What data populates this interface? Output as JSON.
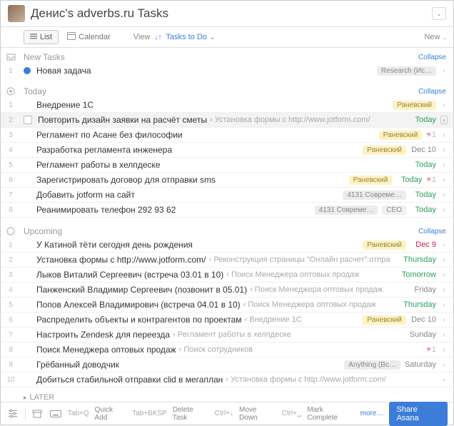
{
  "header": {
    "title": "Денис's adverbs.ru Tasks"
  },
  "toolbar": {
    "list_label": "List",
    "calendar_label": "Calendar",
    "view_label": "View",
    "filter_label": "Tasks to Do",
    "new_label": "New"
  },
  "sections": {
    "new": {
      "title": "New Tasks",
      "collapse": "Collapse"
    },
    "today": {
      "title": "Today",
      "collapse": "Collapse"
    },
    "upcoming": {
      "title": "Upcoming",
      "collapse": "Collapse"
    }
  },
  "tasks": {
    "new": [
      {
        "n": "1",
        "name": "Новая задача",
        "tag": "Research (Ис…",
        "tag_style": "gray"
      }
    ],
    "today": [
      {
        "n": "1",
        "name": "Внедрение 1С",
        "tag": "Раневский",
        "tag_style": "yellow"
      },
      {
        "n": "2",
        "name": "Повторить дизайн заявки на расчёт сметы",
        "sub": "‹ Установка формы с http://www.jotform.com/",
        "due": "Today",
        "due_style": "green",
        "selected": true
      },
      {
        "n": "3",
        "name": "Регламент по Асане без философии",
        "tag": "Раневский",
        "tag_style": "yellow",
        "heart": "1"
      },
      {
        "n": "4",
        "name": "Разработка регламента инженера",
        "tag": "Раневский",
        "tag_style": "yellow",
        "due": "Dec 10"
      },
      {
        "n": "5",
        "name": "Регламент работы в хелпдеске",
        "due": "Today",
        "due_style": "green"
      },
      {
        "n": "6",
        "name": "Зарегистрировать договор для отправки sms",
        "tag": "Раневский",
        "tag_style": "yellow",
        "due": "Today",
        "due_style": "green",
        "heart": "1"
      },
      {
        "n": "7",
        "name": "Добавить jotform на сайт",
        "tag": "4131 Совреме…",
        "tag_style": "gray",
        "due": "Today",
        "due_style": "green"
      },
      {
        "n": "8",
        "name": "Реанимировать телефон 292 93 62",
        "tag": "4131 Совреме…",
        "tag_style": "gray",
        "tag2": "CEO",
        "due": "Today",
        "due_style": "green"
      }
    ],
    "upcoming": [
      {
        "n": "1",
        "name": "У Катиной тёти сегодня день рождения",
        "tag": "Раневский",
        "tag_style": "yellow",
        "due": "Dec 9",
        "due_style": "red"
      },
      {
        "n": "2",
        "name": "Установка формы с http://www.jotform.com/",
        "sub": "‹ Реконструкция страницы \"Онлайн расчет\":отпра",
        "due": "Thursday",
        "due_style": "green"
      },
      {
        "n": "3",
        "name": "Лыков Виталий Сергеевич (встреча 03.01 в 10)",
        "sub": "‹ Поиск Менеджера оптовых продаж",
        "due": "Tomorrow",
        "due_style": "green"
      },
      {
        "n": "4",
        "name": "Панженский Владимир Сергеевич (позвонит в 05.01)",
        "sub": "‹ Поиск Менеджера оптовых продаж",
        "due": "Friday"
      },
      {
        "n": "5",
        "name": "Попов Алексей Владимирович (встреча 04.01 в 10)",
        "sub": "‹ Поиск Менеджера оптовых продаж",
        "due": "Thursday",
        "due_style": "green"
      },
      {
        "n": "6",
        "name": "Распределить объекты и контрагентов по проектам",
        "sub": "‹ Внедрение 1С",
        "tag": "Раневский",
        "tag_style": "yellow",
        "due": "Dec 10"
      },
      {
        "n": "7",
        "name": "Настроить Zendesk для переезда",
        "sub": "‹ Регламент работы в хелпдеске",
        "due": "Sunday"
      },
      {
        "n": "8",
        "name": "Поиск Менеджера оптовых продаж",
        "sub": "‹ Поиск сотрудников",
        "heart": "1"
      },
      {
        "n": "9",
        "name": "Грёбанный доводчик",
        "tag": "Anything (Вс…",
        "tag_style": "gray",
        "due": "Saturday"
      },
      {
        "n": "10",
        "name": "Добиться стабильной отправки clid в мегаплан",
        "sub": "‹ Установка формы с http://www.jotform.com/"
      }
    ]
  },
  "later_label": "LATER",
  "footer": {
    "kb1": "Tab+Q",
    "lbl1": "Quick Add",
    "kb2": "Tab+BKSP",
    "lbl2": "Delete Task",
    "kb3": "Ctrl+↓",
    "lbl3": "Move Down",
    "kb4": "Ctrl+␣",
    "lbl4": "Mark Complete",
    "more": "more…",
    "share": "Share Asana"
  }
}
